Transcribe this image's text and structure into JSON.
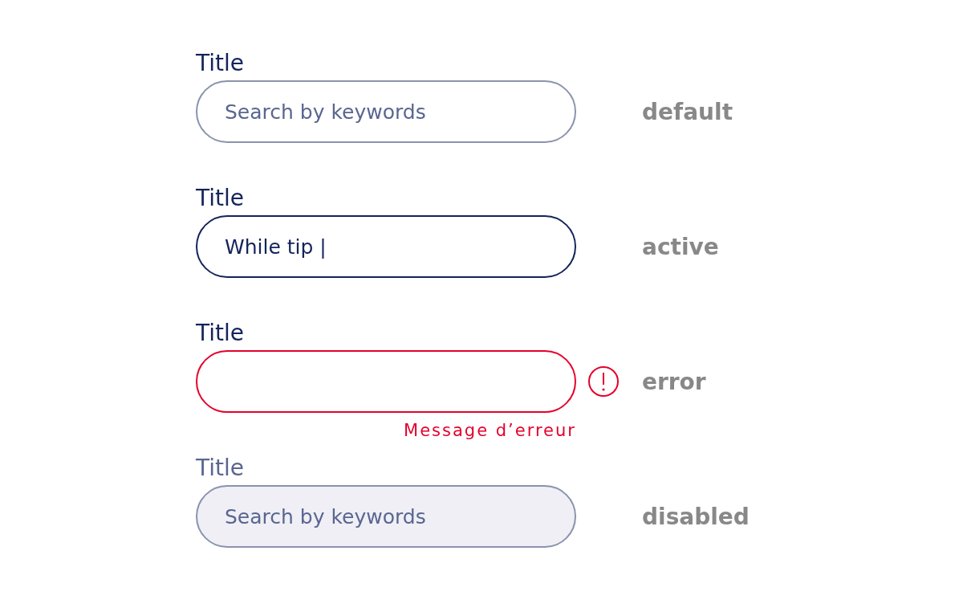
{
  "fields": [
    {
      "kind": "default",
      "title": "Title",
      "placeholder": "Search by keywords",
      "state_label": "default"
    },
    {
      "kind": "active",
      "title": "Title",
      "value": "While tip |",
      "state_label": "active"
    },
    {
      "kind": "error",
      "title": "Title",
      "error_message": "Message d’erreur",
      "state_label": "error"
    },
    {
      "kind": "disabled",
      "title": "Title",
      "placeholder": "Search by keywords",
      "state_label": "disabled"
    }
  ]
}
